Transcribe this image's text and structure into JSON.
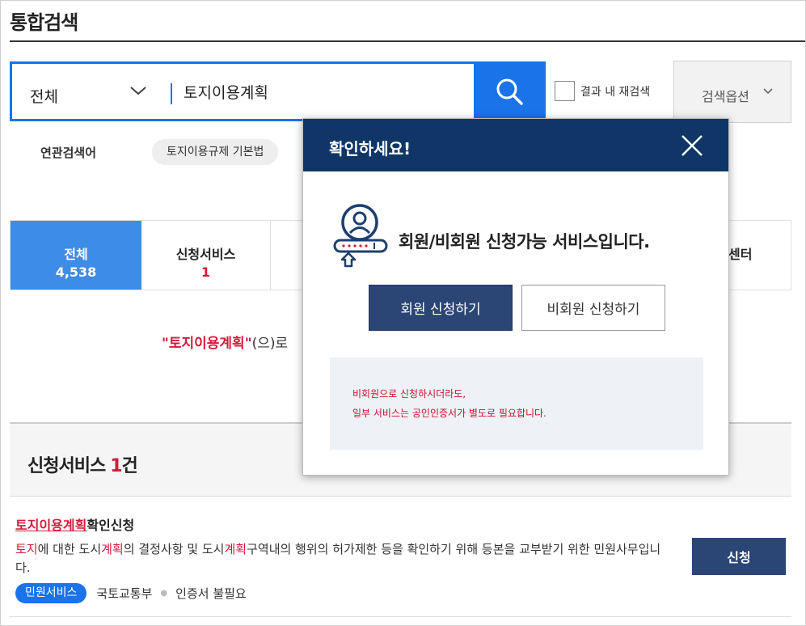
{
  "page": {
    "title": "통합검색"
  },
  "search": {
    "category": "전체",
    "query": "토지이용계획",
    "recheck_label": "결과 내 재검색",
    "options_label": "검색옵션"
  },
  "related": {
    "label": "연관검색어",
    "tags": [
      "토지이용규제 기본법"
    ]
  },
  "tabs": [
    {
      "name": "전체",
      "count": "4,538"
    },
    {
      "name": "신청서비스",
      "count": "1"
    },
    {
      "name": "센터",
      "count": ""
    }
  ],
  "result_message": {
    "keyword": "\"토지이용계획\"",
    "suffix": "(으)로"
  },
  "section": {
    "title": "신청서비스",
    "count": "1",
    "unit": "건"
  },
  "service": {
    "title_highlight": "토지이용계획",
    "title_rest": "확인신청",
    "desc_parts": [
      "토지",
      "에 대한 도시",
      "계획",
      "의 결정사항 및 도시",
      "계획",
      "구역내의 행위의 허가제한 등을 확인하기 위해 등본을 교부받기 위한 민원사무입니다."
    ],
    "badge": "민원서비스",
    "ministry": "국토교통부",
    "cert": "인증서 불필요",
    "apply_label": "신청"
  },
  "modal": {
    "title": "확인하세요!",
    "message": "회원/비회원 신청가능 서비스입니다.",
    "member_button": "회원 신청하기",
    "guest_button": "비회원 신청하기",
    "notice_line1": "비회원으로 신청하시더라도,",
    "notice_line2": "일부 서비스는 공인인증서가 별도로 필요합니다."
  },
  "colors": {
    "accent_blue": "#1a73e8",
    "tab_active": "#3d8ce6",
    "navy": "#2b4575",
    "modal_header": "#0f3666",
    "highlight_red": "#d6193c"
  }
}
